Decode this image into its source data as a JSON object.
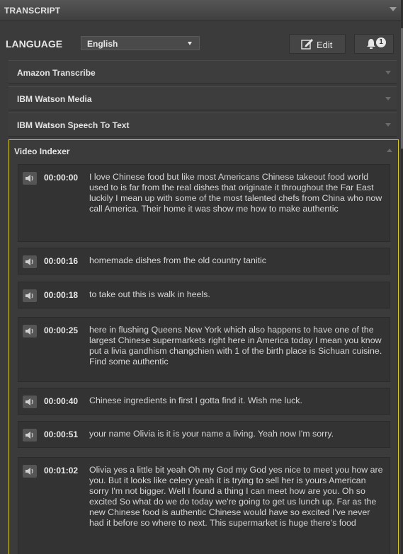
{
  "panel": {
    "title": "TRANSCRIPT"
  },
  "language": {
    "label": "LANGUAGE",
    "selected": "English"
  },
  "toolbar": {
    "edit_label": "Edit",
    "notification_count": "1"
  },
  "providers": [
    {
      "name": "Amazon Transcribe",
      "expanded": false
    },
    {
      "name": "IBM Watson Media",
      "expanded": false
    },
    {
      "name": "IBM Watson Speech To Text",
      "expanded": false
    },
    {
      "name": "Video Indexer",
      "expanded": true
    }
  ],
  "transcript": [
    {
      "time": "00:00:00",
      "text": "I love Chinese food but like most Americans Chinese takeout food world used to is far from the real dishes that originate it throughout the Far East luckily I mean up with some of the most talented chefs from China who now call America. Their home it was show me how to make authentic"
    },
    {
      "time": "00:00:16",
      "text": "homemade dishes from the old country tanitic"
    },
    {
      "time": "00:00:18",
      "text": "to take out this is walk in heels."
    },
    {
      "time": "00:00:25",
      "text": "here in flushing Queens New York which also happens to have one of the largest Chinese supermarkets right here in America today I mean you know put a livia gandhism changchien with 1 of the birth place is Sichuan cuisine. Find some authentic"
    },
    {
      "time": "00:00:40",
      "text": "Chinese ingredients in first I gotta find it. Wish me luck."
    },
    {
      "time": "00:00:51",
      "text": "your name Olivia is it is your name a living. Yeah now I'm sorry."
    },
    {
      "time": "00:01:02",
      "text": "Olivia yes a little bit yeah Oh my God my God yes nice to meet you how are you. But it looks like celery yeah it is trying to sell her is yours American sorry I'm not bigger. Well I found a thing I can meet how are you. Oh so excited So what do we do today we're going to get us lunch up. Far as the new Chinese food is authentic Chinese would have so excited I've never had it before so where to next. This supermarket is huge there's food"
    }
  ],
  "colors": {
    "focus_border": "#d8c92a",
    "panel_bg": "#3b3b3b",
    "entry_bg": "#333333"
  }
}
